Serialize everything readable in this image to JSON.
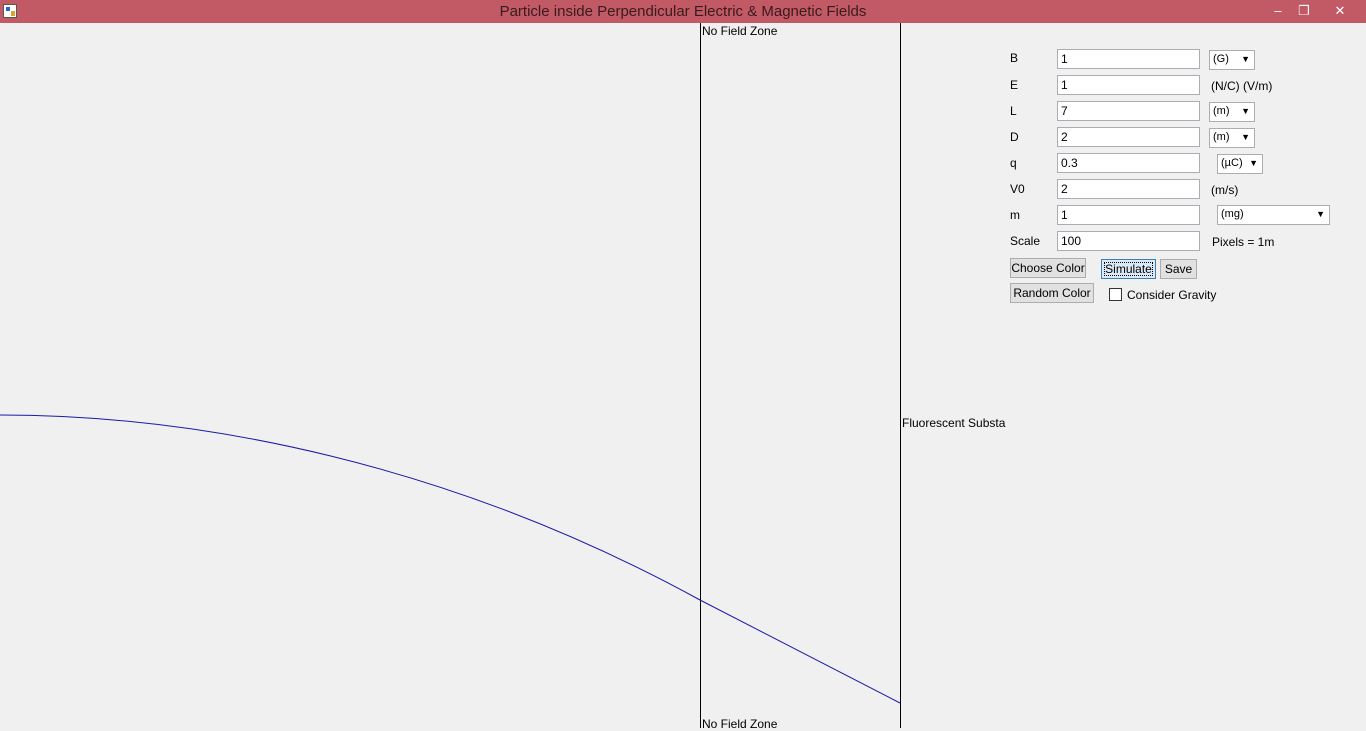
{
  "window": {
    "title": "Particle inside Perpendicular Electric & Magnetic Fields",
    "controls": {
      "minimize": "–",
      "restore": "❐",
      "close": "✕"
    }
  },
  "canvas": {
    "no_field_top": "No Field Zone",
    "no_field_bottom": "No Field Zone",
    "screen_label": "Fluorescent Substa",
    "trajectory_color": "#1a1aa6"
  },
  "params": {
    "B": {
      "label": "B",
      "value": "1",
      "unit": "(G)"
    },
    "E": {
      "label": "E",
      "value": "1",
      "unit": "(N/C) (V/m)"
    },
    "L": {
      "label": "L",
      "value": "7",
      "unit": "(m)"
    },
    "D": {
      "label": "D",
      "value": "2",
      "unit": "(m)"
    },
    "q": {
      "label": "q",
      "value": "0.3",
      "unit": "(µC)"
    },
    "V0": {
      "label": "V0",
      "value": "2",
      "unit": "(m/s)"
    },
    "m": {
      "label": "m",
      "value": "1",
      "unit": "(mg)"
    },
    "scale": {
      "label": "Scale",
      "value": "100",
      "unit": "Pixels = 1m"
    }
  },
  "buttons": {
    "choose_color": "Choose Color",
    "simulate": "Simulate",
    "save": "Save",
    "random_color": "Random Color"
  },
  "gravity": {
    "label": "Consider Gravity",
    "checked": false
  }
}
